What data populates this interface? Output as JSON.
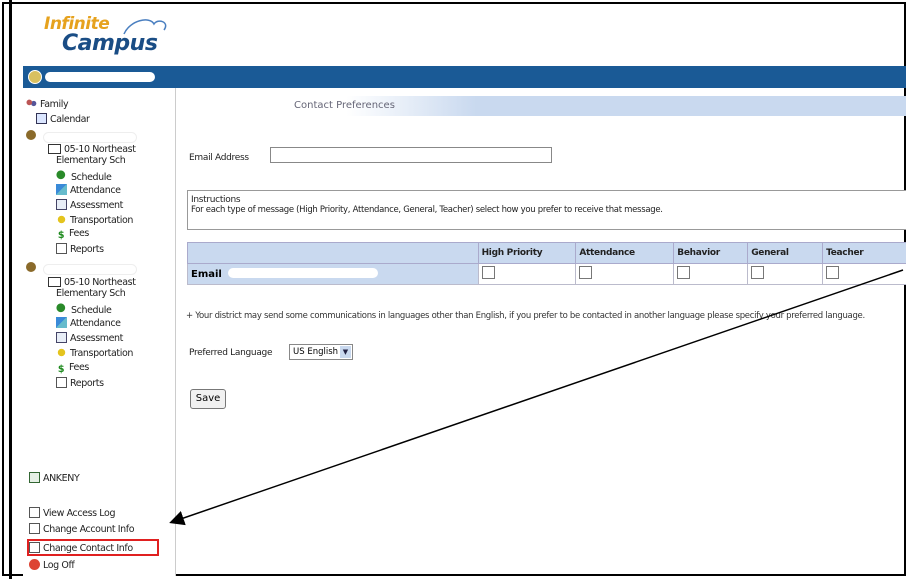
{
  "logo": {
    "line1": "Infinite",
    "line2": "Campus"
  },
  "sidebar": {
    "family_label": "Family",
    "calendar_label": "Calendar",
    "student1": {
      "school": "05-10 Northeast",
      "school2": "Elementary Sch",
      "items": [
        "Schedule",
        "Attendance",
        "Assessment",
        "Transportation",
        "Fees",
        "Reports"
      ]
    },
    "student2": {
      "school": "05-10 Northeast",
      "school2": "Elementary Sch",
      "items": [
        "Schedule",
        "Attendance",
        "Assessment",
        "Transportation",
        "Fees",
        "Reports"
      ]
    },
    "ankeny_label": "ANKENY",
    "links": [
      "View Access Log",
      "Change Account Info",
      "Change Contact Info",
      "Log Off"
    ]
  },
  "main": {
    "header_title": "Contact Preferences",
    "email_label": "Email Address",
    "instructions_title": "Instructions",
    "instructions_text": "For each type of message (High Priority, Attendance, General, Teacher) select how you prefer to receive that message.",
    "table": {
      "headers": [
        "",
        "High Priority",
        "Attendance",
        "Behavior",
        "General",
        "Teacher"
      ],
      "row_label": "Email"
    },
    "note": "+ Your district may send some communications in languages other than English, if you prefer to be contacted in another language please specify your preferred language.",
    "language_label": "Preferred Language",
    "language_value": "US English",
    "save_label": "Save"
  },
  "colors": {
    "topbar": "#1a5a96",
    "header_blue": "#c9d9ef",
    "highlight": "#e02020"
  }
}
